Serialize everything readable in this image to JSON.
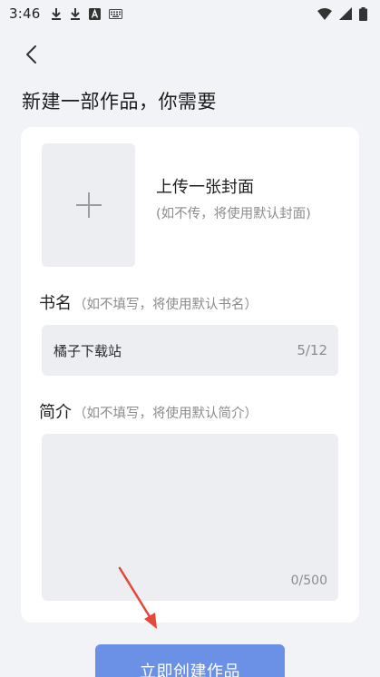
{
  "status_bar": {
    "time": "3:46",
    "left_icons": [
      "download-icon",
      "download-icon",
      "a-box-icon",
      "keyboard-icon"
    ],
    "right_icons": [
      "wifi-icon",
      "signal-icon",
      "battery-icon"
    ]
  },
  "nav": {
    "back_icon": "chevron-left-icon"
  },
  "page": {
    "title": "新建一部作品，你需要"
  },
  "cover": {
    "add_icon": "plus-icon",
    "title": "上传一张封面",
    "hint": "(如不传，将使用默认封面)"
  },
  "book_name": {
    "label": "书名",
    "hint": "（如不填写，将使用默认书名）",
    "value": "橘子下载站",
    "counter": "5/12"
  },
  "intro": {
    "label": "简介",
    "hint": "（如不填写，将使用默认简介）",
    "value": "",
    "counter": "0/500"
  },
  "actions": {
    "create_label": "立即创建作品"
  },
  "colors": {
    "background": "#f2f3f7",
    "card": "#ffffff",
    "input_bg": "#eceef2",
    "primary_button": "#6a91e6",
    "annotation_arrow": "#e5473a",
    "hint_text": "#8c8c8c"
  }
}
